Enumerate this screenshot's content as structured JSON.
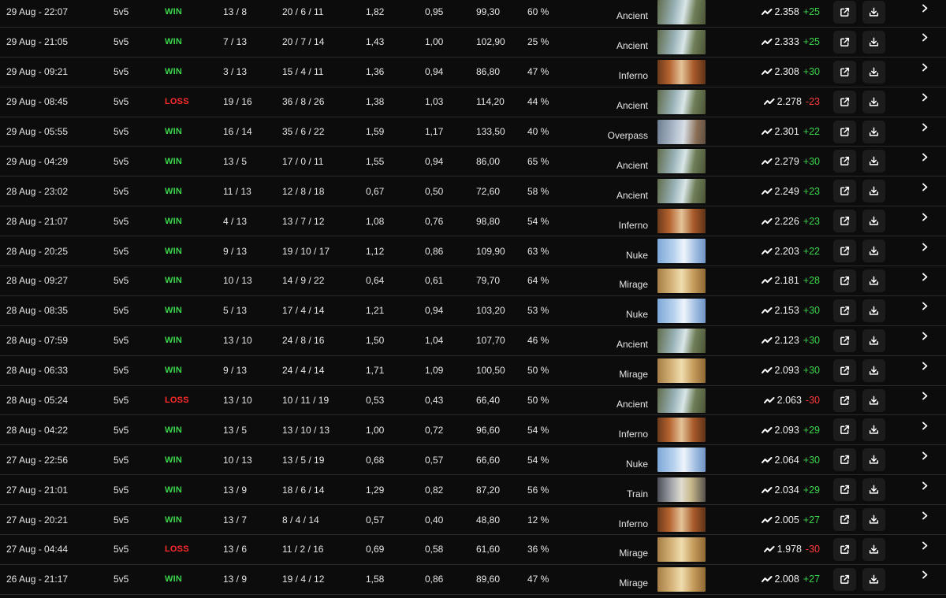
{
  "matches": [
    {
      "date": "29 Aug - 22:07",
      "mode": "5v5",
      "result": "WIN",
      "score": "13 / 8",
      "kda": "20 / 6 / 11",
      "kd": "1,82",
      "kr": "0,95",
      "adr": "99,30",
      "hs": "60 %",
      "map": "Ancient",
      "map_key": "ancient",
      "elo": "2.358",
      "delta": "+25"
    },
    {
      "date": "29 Aug - 21:05",
      "mode": "5v5",
      "result": "WIN",
      "score": "7 / 13",
      "kda": "20 / 7 / 14",
      "kd": "1,43",
      "kr": "1,00",
      "adr": "102,90",
      "hs": "25 %",
      "map": "Ancient",
      "map_key": "ancient",
      "elo": "2.333",
      "delta": "+25"
    },
    {
      "date": "29 Aug - 09:21",
      "mode": "5v5",
      "result": "WIN",
      "score": "3 / 13",
      "kda": "15 / 4 / 11",
      "kd": "1,36",
      "kr": "0,94",
      "adr": "86,80",
      "hs": "47 %",
      "map": "Inferno",
      "map_key": "inferno",
      "elo": "2.308",
      "delta": "+30"
    },
    {
      "date": "29 Aug - 08:45",
      "mode": "5v5",
      "result": "LOSS",
      "score": "19 / 16",
      "kda": "36 / 8 / 26",
      "kd": "1,38",
      "kr": "1,03",
      "adr": "114,20",
      "hs": "44 %",
      "map": "Ancient",
      "map_key": "ancient",
      "elo": "2.278",
      "delta": "-23"
    },
    {
      "date": "29 Aug - 05:55",
      "mode": "5v5",
      "result": "WIN",
      "score": "16 / 14",
      "kda": "35 / 6 / 22",
      "kd": "1,59",
      "kr": "1,17",
      "adr": "133,50",
      "hs": "40 %",
      "map": "Overpass",
      "map_key": "overpass",
      "elo": "2.301",
      "delta": "+22"
    },
    {
      "date": "29 Aug - 04:29",
      "mode": "5v5",
      "result": "WIN",
      "score": "13 / 5",
      "kda": "17 / 0 / 11",
      "kd": "1,55",
      "kr": "0,94",
      "adr": "86,00",
      "hs": "65 %",
      "map": "Ancient",
      "map_key": "ancient",
      "elo": "2.279",
      "delta": "+30"
    },
    {
      "date": "28 Aug - 23:02",
      "mode": "5v5",
      "result": "WIN",
      "score": "11 / 13",
      "kda": "12 / 8 / 18",
      "kd": "0,67",
      "kr": "0,50",
      "adr": "72,60",
      "hs": "58 %",
      "map": "Ancient",
      "map_key": "ancient",
      "elo": "2.249",
      "delta": "+23"
    },
    {
      "date": "28 Aug - 21:07",
      "mode": "5v5",
      "result": "WIN",
      "score": "4 / 13",
      "kda": "13 / 7 / 12",
      "kd": "1,08",
      "kr": "0,76",
      "adr": "98,80",
      "hs": "54 %",
      "map": "Inferno",
      "map_key": "inferno",
      "elo": "2.226",
      "delta": "+23"
    },
    {
      "date": "28 Aug - 20:25",
      "mode": "5v5",
      "result": "WIN",
      "score": "9 / 13",
      "kda": "19 / 10 / 17",
      "kd": "1,12",
      "kr": "0,86",
      "adr": "109,90",
      "hs": "63 %",
      "map": "Nuke",
      "map_key": "nuke",
      "elo": "2.203",
      "delta": "+22"
    },
    {
      "date": "28 Aug - 09:27",
      "mode": "5v5",
      "result": "WIN",
      "score": "10 / 13",
      "kda": "14 / 9 / 22",
      "kd": "0,64",
      "kr": "0,61",
      "adr": "79,70",
      "hs": "64 %",
      "map": "Mirage",
      "map_key": "mirage",
      "elo": "2.181",
      "delta": "+28"
    },
    {
      "date": "28 Aug - 08:35",
      "mode": "5v5",
      "result": "WIN",
      "score": "5 / 13",
      "kda": "17 / 4 / 14",
      "kd": "1,21",
      "kr": "0,94",
      "adr": "103,20",
      "hs": "53 %",
      "map": "Nuke",
      "map_key": "nuke",
      "elo": "2.153",
      "delta": "+30"
    },
    {
      "date": "28 Aug - 07:59",
      "mode": "5v5",
      "result": "WIN",
      "score": "13 / 10",
      "kda": "24 / 8 / 16",
      "kd": "1,50",
      "kr": "1,04",
      "adr": "107,70",
      "hs": "46 %",
      "map": "Ancient",
      "map_key": "ancient",
      "elo": "2.123",
      "delta": "+30"
    },
    {
      "date": "28 Aug - 06:33",
      "mode": "5v5",
      "result": "WIN",
      "score": "9 / 13",
      "kda": "24 / 4 / 14",
      "kd": "1,71",
      "kr": "1,09",
      "adr": "100,50",
      "hs": "50 %",
      "map": "Mirage",
      "map_key": "mirage",
      "elo": "2.093",
      "delta": "+30"
    },
    {
      "date": "28 Aug - 05:24",
      "mode": "5v5",
      "result": "LOSS",
      "score": "13 / 10",
      "kda": "10 / 11 / 19",
      "kd": "0,53",
      "kr": "0,43",
      "adr": "66,40",
      "hs": "50 %",
      "map": "Ancient",
      "map_key": "ancient",
      "elo": "2.063",
      "delta": "-30"
    },
    {
      "date": "28 Aug - 04:22",
      "mode": "5v5",
      "result": "WIN",
      "score": "13 / 5",
      "kda": "13 / 10 / 13",
      "kd": "1,00",
      "kr": "0,72",
      "adr": "96,60",
      "hs": "54 %",
      "map": "Inferno",
      "map_key": "inferno",
      "elo": "2.093",
      "delta": "+29"
    },
    {
      "date": "27 Aug - 22:56",
      "mode": "5v5",
      "result": "WIN",
      "score": "10 / 13",
      "kda": "13 / 5 / 19",
      "kd": "0,68",
      "kr": "0,57",
      "adr": "66,60",
      "hs": "54 %",
      "map": "Nuke",
      "map_key": "nuke",
      "elo": "2.064",
      "delta": "+30"
    },
    {
      "date": "27 Aug - 21:01",
      "mode": "5v5",
      "result": "WIN",
      "score": "13 / 9",
      "kda": "18 / 6 / 14",
      "kd": "1,29",
      "kr": "0,82",
      "adr": "87,20",
      "hs": "56 %",
      "map": "Train",
      "map_key": "train",
      "elo": "2.034",
      "delta": "+29"
    },
    {
      "date": "27 Aug - 20:21",
      "mode": "5v5",
      "result": "WIN",
      "score": "13 / 7",
      "kda": "8 / 4 / 14",
      "kd": "0,57",
      "kr": "0,40",
      "adr": "48,80",
      "hs": "12 %",
      "map": "Inferno",
      "map_key": "inferno",
      "elo": "2.005",
      "delta": "+27"
    },
    {
      "date": "27 Aug - 04:44",
      "mode": "5v5",
      "result": "LOSS",
      "score": "13 / 6",
      "kda": "11 / 2 / 16",
      "kd": "0,69",
      "kr": "0,58",
      "adr": "61,60",
      "hs": "36 %",
      "map": "Mirage",
      "map_key": "mirage",
      "elo": "1.978",
      "delta": "-30"
    },
    {
      "date": "26 Aug - 21:17",
      "mode": "5v5",
      "result": "WIN",
      "score": "13 / 9",
      "kda": "19 / 4 / 12",
      "kd": "1,58",
      "kr": "0,86",
      "adr": "89,60",
      "hs": "47 %",
      "map": "Mirage",
      "map_key": "mirage",
      "elo": "2.008",
      "delta": "+27"
    }
  ],
  "icons": {
    "elo_trend": "trend-icon",
    "open_match": "external-link-icon",
    "download_demo": "download-icon",
    "expand_row": "chevron-right-icon"
  },
  "colors": {
    "background": "#0c0c0c",
    "win": "#3ad64b",
    "loss": "#ff2b2b",
    "button_bg": "#1c1c1c"
  }
}
